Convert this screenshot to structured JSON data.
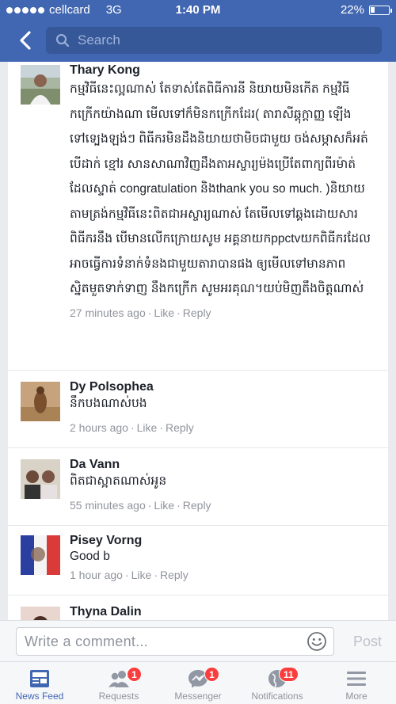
{
  "status_bar": {
    "carrier": "cellcard",
    "network": "3G",
    "time": "1:40 PM",
    "battery": "22%",
    "battery_level": 0.22,
    "signal_bars_filled": 5
  },
  "nav": {
    "back_icon": "back-chevron-icon",
    "search_placeholder": "Search"
  },
  "comments": [
    {
      "name": "Thary Kong",
      "text": "កម្មវិធីនេះល្អណាស់ តែទាស់តែពិធីការនី និយាយមិនកើត កម្មវិធីកក្រើកយ៉ាងណា មើលទៅក៏មិនកក្រើកដែរ( តារាសីឆ្តុក្តាញ្ញ ឡើងទៅទ្បេងឡង់ៗ ពិធីករមិនដឹងនិយាយថាមិចជាមួយ ចង់សម្ភាសក៏អត់ បើដាក់ ខ្មៅរ សានសាណាវិញដឹងតាអស្ចារ្យម៉ងប្រើតែពាក្យពីរម៉ាត់ដែលស្ទាត់ congratulation និងthank you so much. )និយាយតាមត្រង់កម្មវិធីនេះពិតជាអស្ចារ្យណាស់ តែមើលទៅឆ្គងដោយសារពិធីករនឹង បើមានលើកក្រោយសូម អគ្គនាយកppctvយកពិធីករដែលអាចធ្វើការទំនាក់ទំនងជាមួយតារាបានផង ឲ្យមើលទៅមានភាពស្និតមួតទាក់ទាញ នឹងកក្រើក សូមអរគុណ។យប់មិញតឹងចិត្តណាស់",
      "time": "27 minutes ago",
      "like": "Like",
      "reply": "Reply"
    },
    {
      "name": "Dy Polsophea",
      "text": "នឹកបងណាស់បង",
      "time": "2 hours ago",
      "like": "Like",
      "reply": "Reply"
    },
    {
      "name": "Da Vann",
      "text": "ពិតជាស្អាតណាស់អូន",
      "time": "55 minutes ago",
      "like": "Like",
      "reply": "Reply"
    },
    {
      "name": "Pisey Vorng",
      "text": "Good b",
      "time": "1 hour ago",
      "like": "Like",
      "reply": "Reply"
    },
    {
      "name": "Thyna Dalin",
      "text": "",
      "time": "",
      "like": "",
      "reply": ""
    }
  ],
  "composer": {
    "placeholder": "Write a comment...",
    "emoji_icon": "smiley-icon",
    "post_label": "Post"
  },
  "tabs": [
    {
      "label": "News Feed",
      "icon": "news-feed-icon",
      "badge": "",
      "active": true
    },
    {
      "label": "Requests",
      "icon": "friend-requests-icon",
      "badge": "1",
      "active": false
    },
    {
      "label": "Messenger",
      "icon": "messenger-icon",
      "badge": "1",
      "active": false
    },
    {
      "label": "Notifications",
      "icon": "globe-icon",
      "badge": "11",
      "active": false
    },
    {
      "label": "More",
      "icon": "hamburger-menu-icon",
      "badge": "",
      "active": false
    }
  ],
  "colors": {
    "brand_blue": "#4267b2",
    "badge_red": "#fa3e3e",
    "meta_gray": "#90949c"
  }
}
